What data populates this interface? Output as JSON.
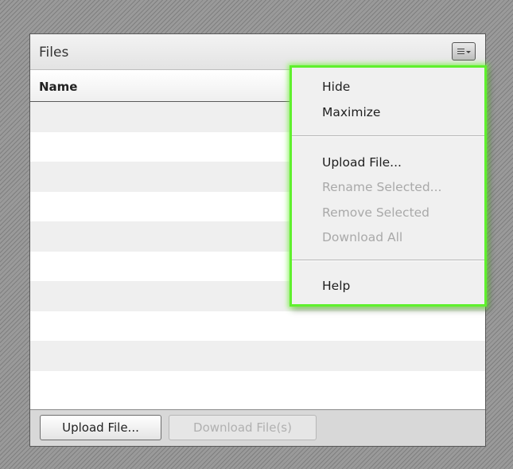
{
  "pod": {
    "title": "Files",
    "column_header": "Name",
    "row_count": 10
  },
  "footer": {
    "upload_label": "Upload File...",
    "download_label": "Download File(s)"
  },
  "menu": {
    "hide": "Hide",
    "maximize": "Maximize",
    "upload": "Upload File...",
    "rename": "Rename Selected...",
    "remove": "Remove Selected",
    "download_all": "Download All",
    "help": "Help"
  },
  "icons": {
    "options_button": "menu-lines-icon",
    "options_caret": "chevron-down-icon"
  },
  "colors": {
    "menu_highlight": "#5ff02d",
    "disabled_text": "#a9a9a9"
  }
}
